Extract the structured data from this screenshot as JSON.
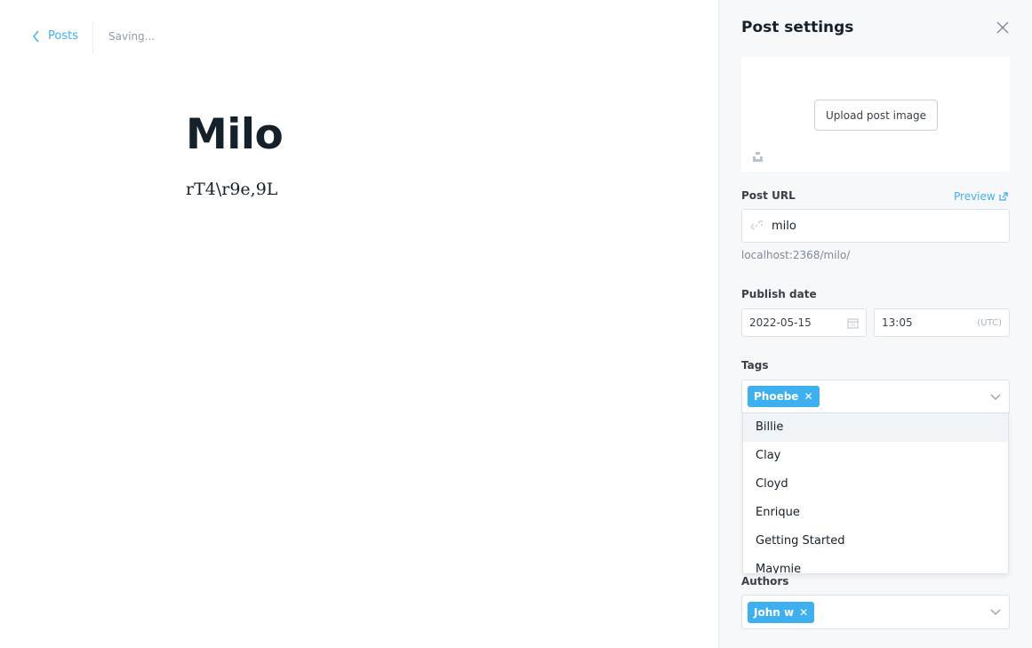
{
  "editor": {
    "back_label": "Posts",
    "status": "Saving...",
    "title": "Milo",
    "body": "rT4\\r9e,9L"
  },
  "settings": {
    "title": "Post settings",
    "upload_label": "Upload post image",
    "post_url_label": "Post URL",
    "preview_label": "Preview",
    "url_value": "milo",
    "url_hint": "localhost:2368/milo/",
    "publish_date_label": "Publish date",
    "date_value": "2022-05-15",
    "time_value": "13:05",
    "timezone": "(UTC)",
    "tags_label": "Tags",
    "selected_tag": "Phoebe",
    "tag_options": [
      "Billie",
      "Clay",
      "Cloyd",
      "Enrique",
      "Getting Started",
      "Maymie"
    ],
    "authors_label": "Authors",
    "selected_author": "John w"
  },
  "colors": {
    "accent": "#3eb0ef",
    "panel_bg": "#f7f8fa"
  }
}
